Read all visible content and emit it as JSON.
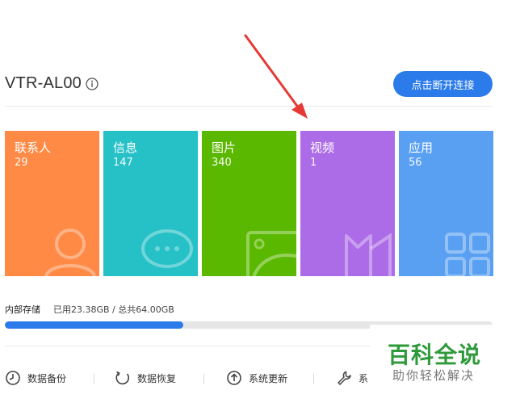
{
  "header": {
    "device_name": "VTR-AL00",
    "disconnect_label": "点击断开连接"
  },
  "categories": [
    {
      "label": "联系人",
      "count": "29",
      "color": "#ff8a46"
    },
    {
      "label": "信息",
      "count": "147",
      "color": "#26c0c7"
    },
    {
      "label": "图片",
      "count": "340",
      "color": "#5bb800"
    },
    {
      "label": "视频",
      "count": "1",
      "color": "#ad6ce7"
    },
    {
      "label": "应用",
      "count": "56",
      "color": "#5aa0f2"
    }
  ],
  "storage": {
    "label": "内部存储",
    "usage_text": "已用23.38GB / 总共64.00GB",
    "used_fraction": 0.3653
  },
  "toolbar": {
    "backup_label": "数据备份",
    "restore_label": "数据恢复",
    "update_label": "系统更新",
    "fourth_label": "系"
  },
  "watermark": {
    "title": "百科全说",
    "subtitle": "助你轻松解决"
  },
  "colors": {
    "accent": "#2b7bea",
    "annotation_arrow": "#e53a35",
    "watermark_green": "#2e9a3a"
  }
}
